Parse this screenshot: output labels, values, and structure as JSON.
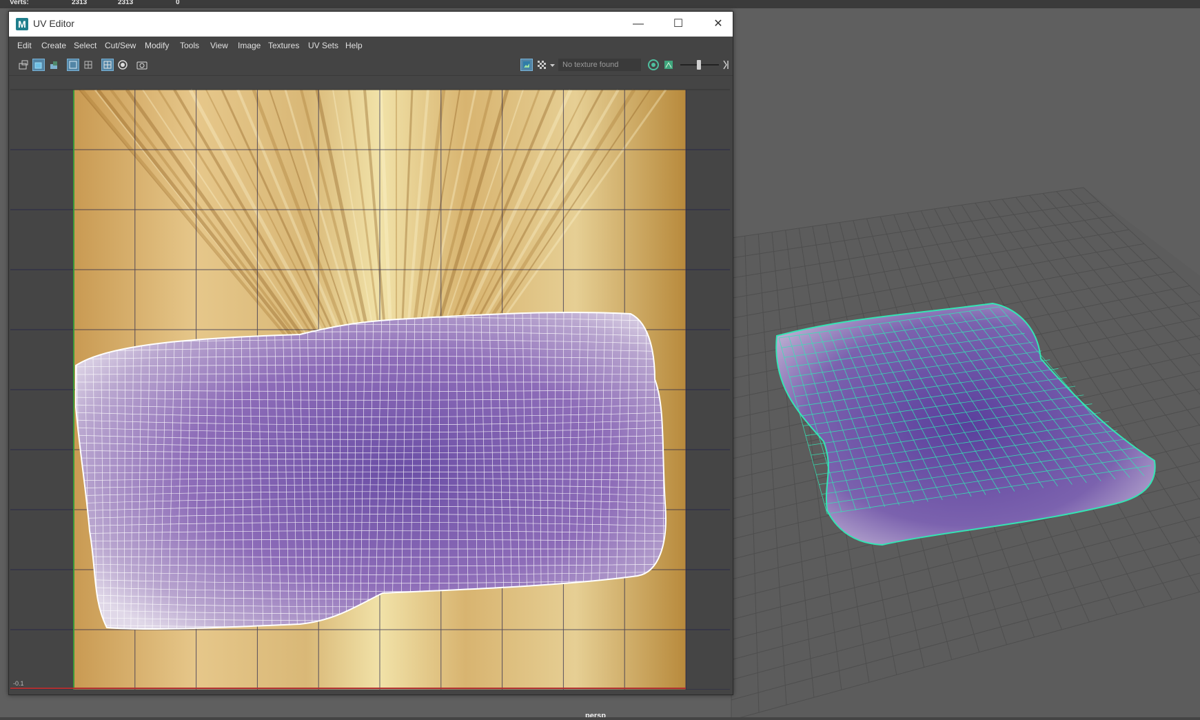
{
  "hud": {
    "label": "Verts:",
    "col1": "2313",
    "col2": "2313",
    "col3": "0"
  },
  "uv_editor": {
    "title": "UV Editor",
    "app_logo": "M",
    "window_controls": {
      "minimize": "—",
      "maximize": "☐",
      "close": "✕"
    },
    "menu": [
      "Edit",
      "Create",
      "Select",
      "Cut/Sew",
      "Modify",
      "Tools",
      "View",
      "Image",
      "Textures",
      "UV Sets",
      "Help"
    ],
    "toolbar": {
      "icons": [
        "uv-snapshot-icon",
        "shaded-uv-icon",
        "texture-borders-icon",
        "wireframe-display-icon",
        "distortion-icon",
        "grid-icon",
        "pixel-snap-icon",
        "camera-icon",
        "image-display-icon",
        "checker-icon",
        "dropdown-arrow-icon",
        "exposure-icon",
        "gamma-icon",
        "collapse-icon"
      ],
      "texture_status": "No texture found"
    },
    "canvas": {
      "coord_label": "-0.1",
      "texture_colors": {
        "light": "#f1e2a8",
        "mid": "#d8b470",
        "dark": "#b88a3c"
      },
      "uv_shell_color": "#8d6cb8",
      "wire_color": "#ffffff",
      "grid_color": "#1d1d4a"
    }
  },
  "viewport": {
    "camera_label": "persp",
    "mesh_wire_color": "#34e5b4",
    "mesh_fill_color": "#7b62ae"
  }
}
